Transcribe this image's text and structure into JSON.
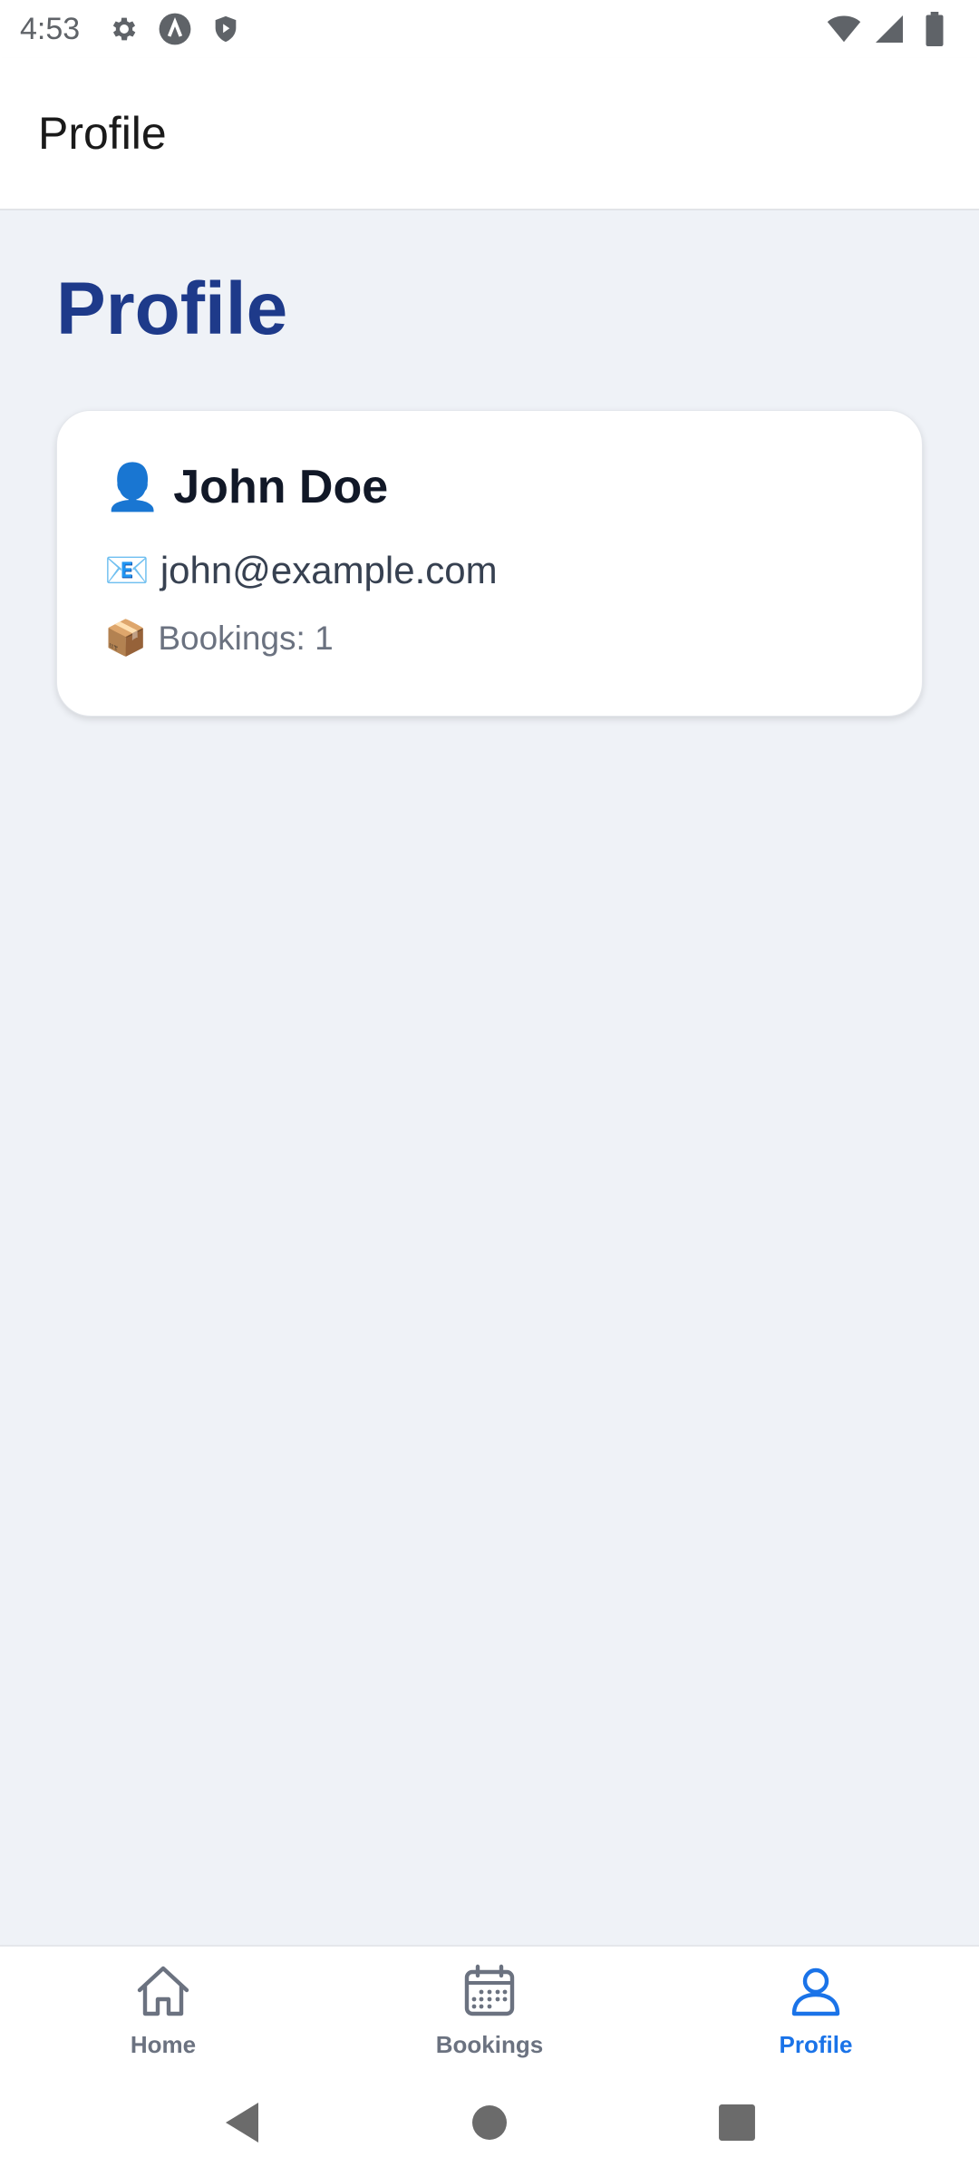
{
  "status_bar": {
    "time": "4:53",
    "left_icons": [
      "settings-icon",
      "a-circle-icon",
      "shield-play-icon"
    ],
    "right_icons": [
      "wifi-icon",
      "signal-icon",
      "battery-icon"
    ]
  },
  "app_bar": {
    "title": "Profile"
  },
  "page": {
    "heading": "Profile"
  },
  "profile": {
    "name_emoji": "👤",
    "name": "John Doe",
    "email_emoji": "📧",
    "email": "john@example.com",
    "bookings_emoji": "📦",
    "bookings_text": "Bookings: 1"
  },
  "bottom_nav": {
    "tabs": [
      {
        "label": "Home",
        "icon": "home-icon",
        "active": false
      },
      {
        "label": "Bookings",
        "icon": "calendar-icon",
        "active": false
      },
      {
        "label": "Profile",
        "icon": "person-icon",
        "active": true
      }
    ]
  },
  "colors": {
    "accent": "#1a73e8",
    "heading": "#1e3a8a",
    "background": "#eff2f7",
    "inactive": "#6b7280"
  }
}
